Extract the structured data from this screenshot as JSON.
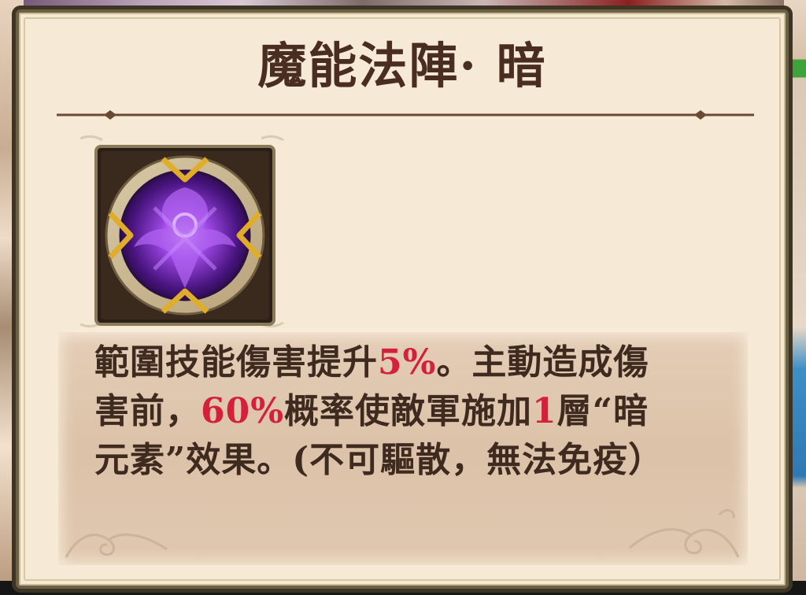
{
  "popup": {
    "title": "魔能法陣· 暗",
    "icon": "dark-magic-array-icon",
    "description": [
      {
        "text": "範圍技能傷害提升",
        "highlight": false
      },
      {
        "text": "5%",
        "highlight": true
      },
      {
        "text": "。主動造成傷害前，",
        "highlight": false
      },
      {
        "text": "60%",
        "highlight": true
      },
      {
        "text": "概率使敵軍施加",
        "highlight": false
      },
      {
        "text": "1",
        "highlight": true
      },
      {
        "text": "層“暗元素”效果。(不可驅散，無法免疫）",
        "highlight": false
      }
    ]
  },
  "colors": {
    "title": "#4a2d21",
    "text": "#3f2a20",
    "highlight": "#d4213b",
    "panel": "#f6ead6",
    "frame": "#6b5f45",
    "icon_core": "#7a2fc4",
    "icon_gold": "#d8a227"
  }
}
